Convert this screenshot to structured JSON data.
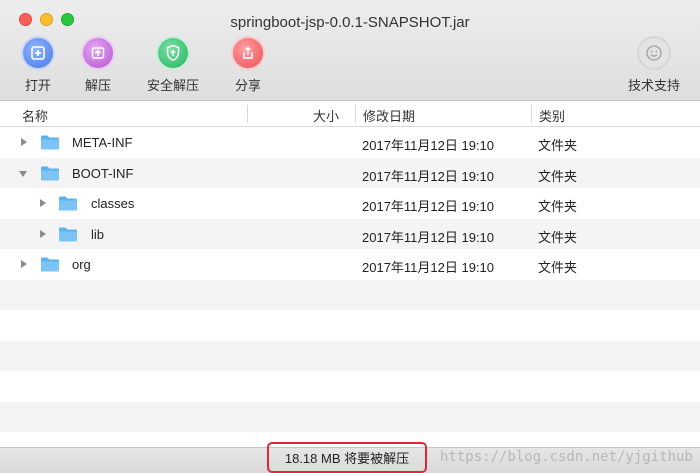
{
  "window": {
    "title": "springboot-jsp-0.0.1-SNAPSHOT.jar"
  },
  "toolbar": {
    "open_label": "打开",
    "extract_label": "解压",
    "safe_extract_label": "安全解压",
    "share_label": "分享",
    "support_label": "技术支持"
  },
  "columns": {
    "name": "名称",
    "size": "大小",
    "modified": "修改日期",
    "kind": "类别"
  },
  "rows": [
    {
      "name": "META-INF",
      "date": "2017年11月12日 19:10",
      "kind": "文件夹"
    },
    {
      "name": "BOOT-INF",
      "date": "2017年11月12日 19:10",
      "kind": "文件夹"
    },
    {
      "name": "classes",
      "date": "2017年11月12日 19:10",
      "kind": "文件夹"
    },
    {
      "name": "lib",
      "date": "2017年11月12日 19:10",
      "kind": "文件夹"
    },
    {
      "name": "org",
      "date": "2017年11月12日 19:10",
      "kind": "文件夹"
    }
  ],
  "status": {
    "text": "18.18 MB 将要被解压"
  },
  "watermark": "https://blog.csdn.net/yjgithub",
  "colors": {
    "folder": "#5ab2f0",
    "highlight_border": "#e2263a"
  }
}
